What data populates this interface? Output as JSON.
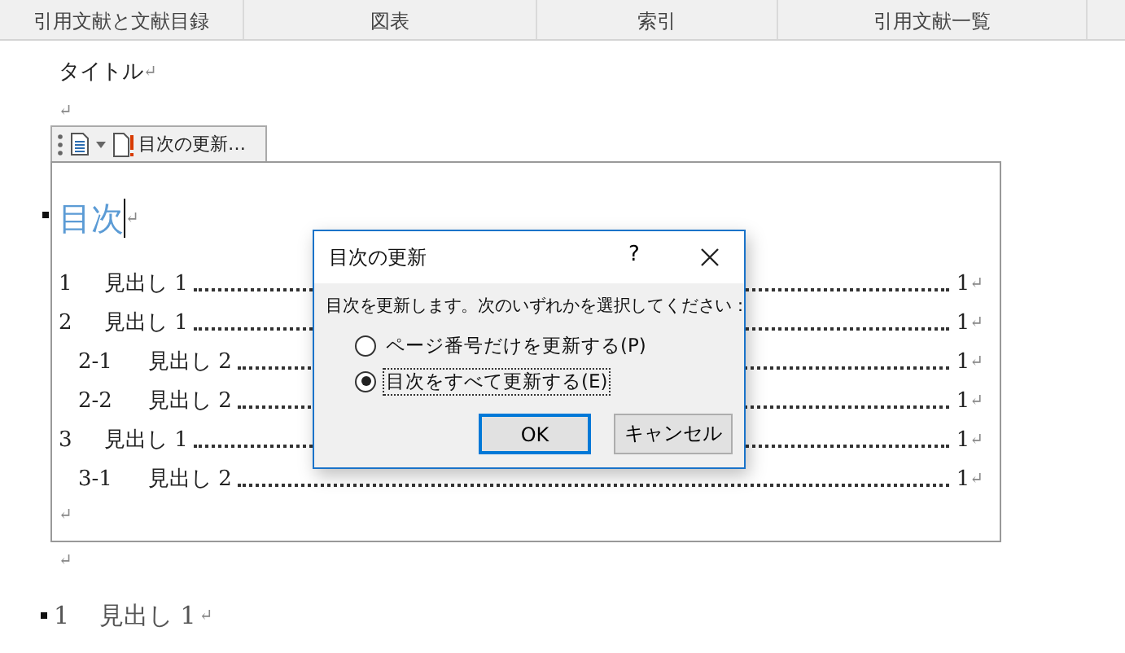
{
  "ribbon": {
    "groups": [
      "引用文献と文献目録",
      "図表",
      "索引",
      "引用文献一覧"
    ]
  },
  "document": {
    "title": {
      "text": "タイトル",
      "mark": "↵"
    },
    "blank_mark": "↵",
    "toc_toolbar": {
      "label": "目次の更新…"
    },
    "toc": {
      "heading": "目次",
      "heading_mark": "↵",
      "entries": [
        {
          "number": "1",
          "text": "見出し 1",
          "page": "1",
          "mark": "↵"
        },
        {
          "number": "2",
          "text": "見出し 1",
          "page": "1",
          "mark": "↵",
          "children": [
            {
              "number": "2-1",
              "text": "見出し 2",
              "page": "1",
              "mark": "↵"
            },
            {
              "number": "2-2",
              "text": "見出し 2",
              "page": "1",
              "mark": "↵"
            }
          ]
        },
        {
          "number": "3",
          "text": "見出し 1",
          "page": "1",
          "mark": "↵",
          "children": [
            {
              "number": "3-1",
              "text": "見出し 2",
              "page": "1",
              "mark": "↵"
            }
          ]
        }
      ],
      "end_mark": "↵"
    },
    "after_mark": "↵",
    "heading": {
      "number": "1",
      "text": "見出し 1",
      "mark": "↵"
    }
  },
  "dialog": {
    "title": "目次の更新",
    "help": "?",
    "message": "目次を更新します。次のいずれかを選択してください：",
    "options": [
      {
        "label": "ページ番号だけを更新する(P)",
        "selected": false
      },
      {
        "label": "目次をすべて更新する(E)",
        "selected": true
      }
    ],
    "buttons": [
      {
        "label": "OK",
        "default": true
      },
      {
        "label": "キャンセル",
        "default": false
      }
    ]
  }
}
